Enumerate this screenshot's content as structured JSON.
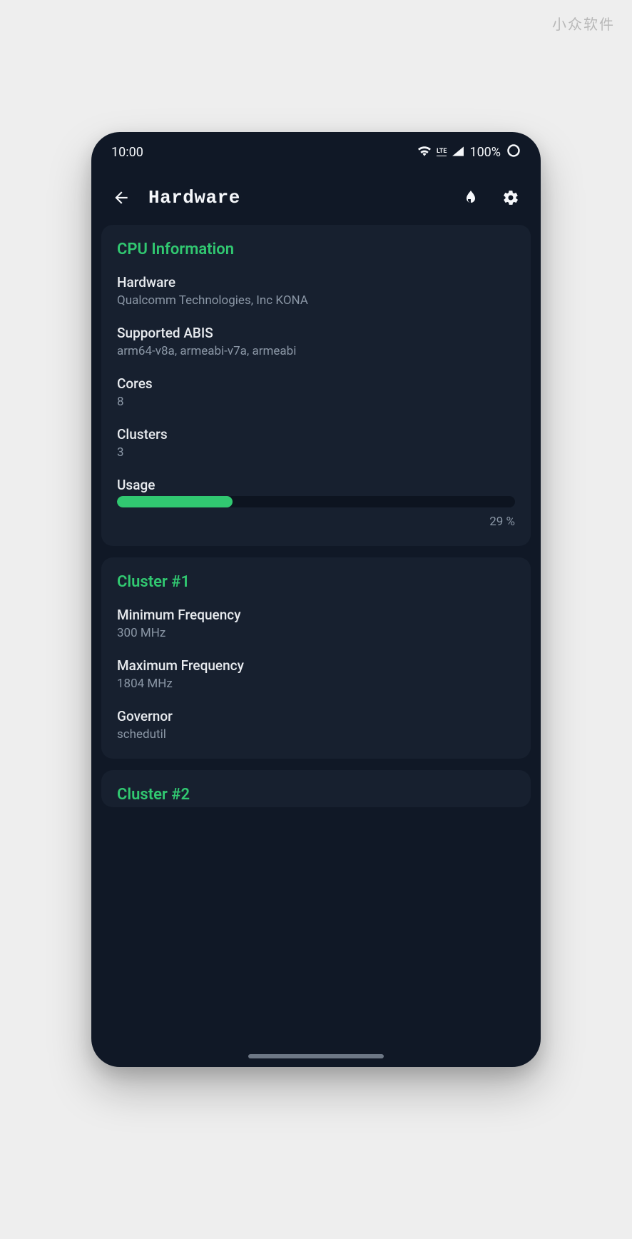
{
  "watermark": "小众软件",
  "statusbar": {
    "time": "10:00",
    "battery": "100%"
  },
  "appbar": {
    "title": "Hardware"
  },
  "cards": {
    "cpu": {
      "title": "CPU Information",
      "hardware_label": "Hardware",
      "hardware_value": "Qualcomm Technologies, Inc KONA",
      "abis_label": "Supported ABIS",
      "abis_value": "arm64-v8a, armeabi-v7a, armeabi",
      "cores_label": "Cores",
      "cores_value": "8",
      "clusters_label": "Clusters",
      "clusters_value": "3",
      "usage_label": "Usage",
      "usage_percent": 29,
      "usage_text": "29 %"
    },
    "cluster1": {
      "title": "Cluster #1",
      "minfreq_label": "Minimum Frequency",
      "minfreq_value": "300 MHz",
      "maxfreq_label": "Maximum Frequency",
      "maxfreq_value": "1804 MHz",
      "governor_label": "Governor",
      "governor_value": "schedutil"
    },
    "cluster2": {
      "title": "Cluster #2"
    }
  }
}
